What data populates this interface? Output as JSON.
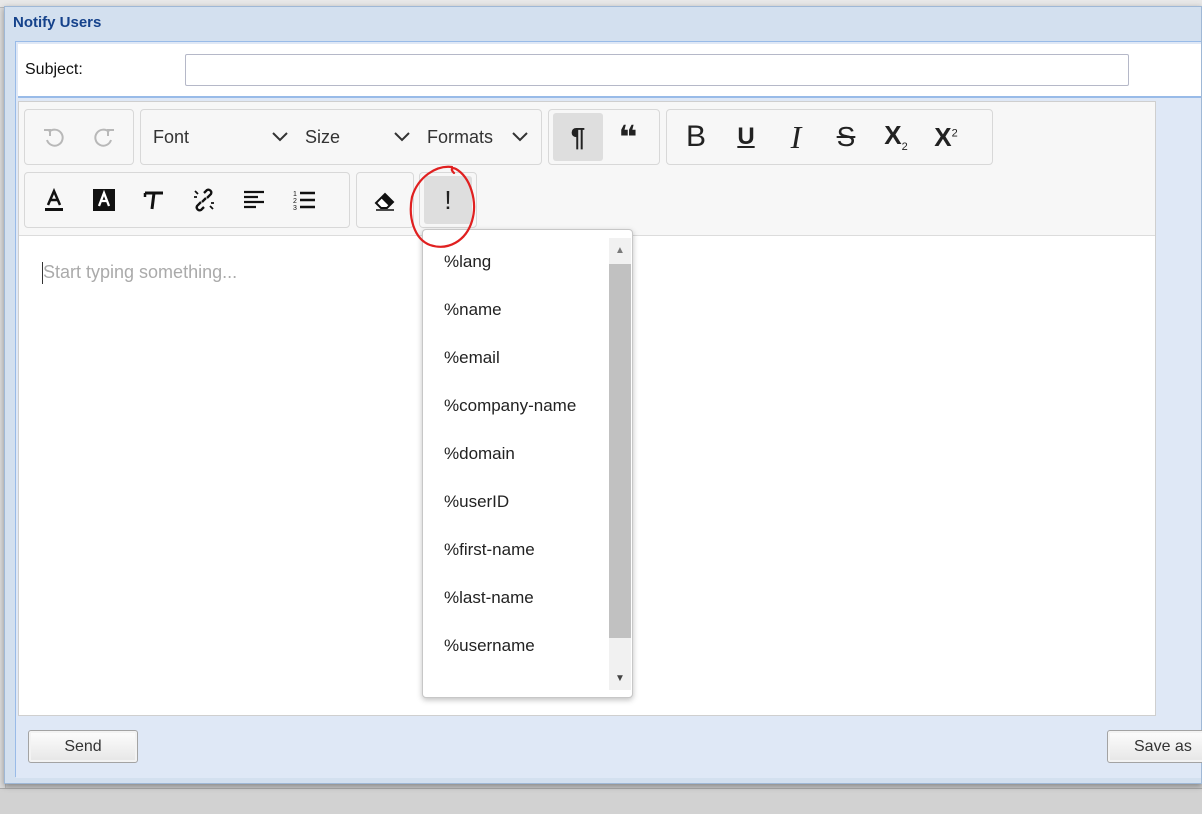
{
  "dialog": {
    "title": "Notify Users"
  },
  "subject": {
    "label": "Subject:",
    "value": ""
  },
  "toolbar": {
    "undo": "undo-icon",
    "redo": "redo-icon",
    "font_label": "Font",
    "size_label": "Size",
    "formats_label": "Formats",
    "paragraph_glyph": "¶",
    "blockquote_glyph": "❝",
    "bold_glyph": "B",
    "underline_glyph": "U",
    "italic_glyph": "I",
    "strike_glyph": "S",
    "subscript_glyph": "X",
    "subscript_small": "2",
    "superscript_glyph": "X",
    "superscript_small": "2",
    "placeholder_insert_glyph": "!"
  },
  "editor": {
    "placeholder": "Start typing something..."
  },
  "placeholder_menu": {
    "items": [
      "%lang",
      "%name",
      "%email",
      "%company-name",
      "%domain",
      "%userID",
      "%first-name",
      "%last-name",
      "%username"
    ]
  },
  "footer": {
    "send_label": "Send",
    "save_as_label": "Save as"
  },
  "colors": {
    "title": "#15428b",
    "dialog_bg": "#dfe8f6",
    "annotation": "#e02020"
  }
}
